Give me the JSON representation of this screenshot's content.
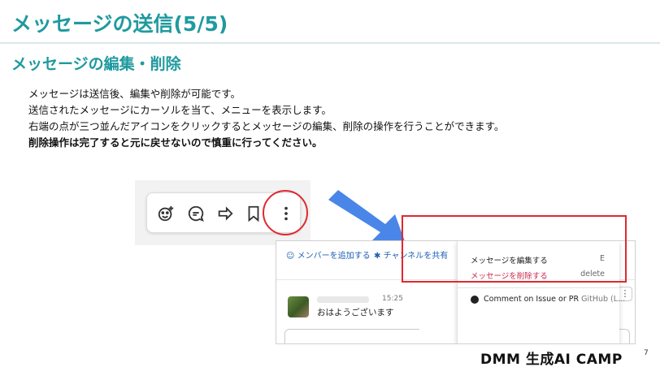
{
  "slide": {
    "title": "メッセージの送信(5/5)",
    "subtitle": "メッセージの編集・削除",
    "lines": [
      "メッセージは送信後、編集や削除が可能です。",
      "送信されたメッセージにカーソルを当て、メニューを表示します。",
      "右端の点が三つ並んだアイコンをクリックするとメッセージの編集、削除の操作を行うことができます。"
    ],
    "bold_line": "削除操作は完了すると元に戻せないので慎重に行ってください。",
    "page_number": "7",
    "logo": "DMM 生成AI CAMP"
  },
  "toolbar": {
    "icons": [
      "add-reaction-icon",
      "reply-thread-icon",
      "share-icon",
      "bookmark-icon",
      "more-actions-icon"
    ]
  },
  "slack": {
    "add_member": "メンバーを追加する",
    "share_channel": "チャンネルを共有",
    "message_time": "15:25",
    "message_text": "おはようございます",
    "menu": {
      "edit_label": "メッセージを編集する",
      "edit_key": "E",
      "delete_label": "メッセージを削除する",
      "delete_key": "delete",
      "github_label": "Comment on Issue or PR",
      "github_app": "GitHub (L..."
    }
  },
  "colors": {
    "accent": "#1f9a9f",
    "highlight": "#e0282f",
    "arrow": "#4a86e8",
    "delete_text": "#c8284e"
  }
}
